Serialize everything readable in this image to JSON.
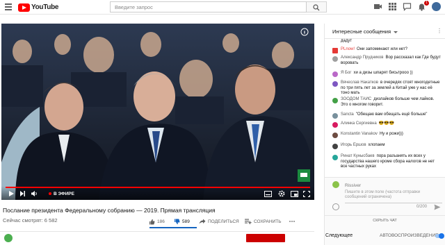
{
  "header": {
    "logo_text": "YouTube",
    "search_placeholder": "Введите запрос",
    "notifications_count": "1"
  },
  "player": {
    "live_label": "В ЭФИРЕ",
    "progress": 1.0,
    "accent_color": "#ff0000"
  },
  "video": {
    "title": "Послание президента Федеральному собранию — 2019. Прямая трансляция",
    "views": "Сейчас смотрят: 6 582",
    "likes": "186",
    "dislikes": "589",
    "share_label": "ПОДЕЛИТЬСЯ",
    "save_label": "СОХРАНИТЬ"
  },
  "chat": {
    "header": "Интересные сообщения",
    "messages": [
      {
        "author": "",
        "text": "дадут",
        "avatar_color": "#ffffff"
      },
      {
        "author": "PLnow!",
        "text": "Они запоминают или нет?",
        "avatar_color": "#e53935"
      },
      {
        "author": "Александр Прудников",
        "text": "Вор рассказал как Где будут воровать",
        "avatar_color": "#9e9e9e"
      },
      {
        "author": "Я Бог",
        "text": "хи а дизы шпарят бисьтрооо ))",
        "avatar_color": "#ba68c8"
      },
      {
        "author": "Вячеслав Накатков",
        "text": "в очередях стоят многодетные по три пять лет за землей а Китай уже у нас её тоно мать",
        "avatar_color": "#7e57c2"
      },
      {
        "author": "ЗООДОМ ТАИС",
        "text": "дизлайков больше чем лайков. Это о многом говорит.",
        "avatar_color": "#43a047"
      },
      {
        "author": "Sancta",
        "text": "\"Обещаю вам обещать ещё больше\"",
        "avatar_color": "#78909c"
      },
      {
        "author": "Алинка Сергиевна",
        "text": "😎😎😎",
        "avatar_color": "#d81b60"
      },
      {
        "author": "Konstantin Vanakov",
        "text": "Ну и рожи)))",
        "avatar_color": "#6d4c41"
      },
      {
        "author": "Игорь Ершов",
        "text": "хлопаем",
        "avatar_color": "#424242"
      },
      {
        "author": "Ринат Кунысбаев",
        "text": "пора разъанять их всех у государства нашего кроме сбора налогов не нет все частных руках",
        "avatar_color": "#26a69a"
      }
    ],
    "input_user": "Rissiver",
    "input_placeholder": "Пишите в этом поле (частота отправки сообщений ограничена)",
    "counter": "0/200",
    "hide_label": "СКРЫТЬ ЧАТ"
  },
  "sidebar": {
    "next_label": "Следующее",
    "autoplay_label": "АВТОВОСПРОИЗВЕДЕНИЕ"
  }
}
